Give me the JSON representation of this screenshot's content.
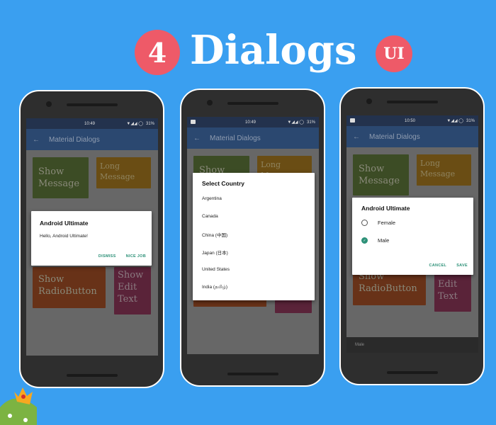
{
  "header": {
    "count": "4",
    "title": "Dialogs",
    "badge": "UI"
  },
  "colors": {
    "background": "#3a9ff0",
    "badge": "#ee5a68",
    "appbar": "#2b4870",
    "accent": "#2d9178"
  },
  "app": {
    "title": "Material Dialogs",
    "battery": "31%",
    "tiles": {
      "show_message": "Show Message",
      "long_message": "Long Message",
      "show_radio": "Show RadioButton",
      "show_edit": "Show Edit Text"
    }
  },
  "phones": [
    {
      "time": "10:49",
      "dialog": {
        "title": "Android Ultimate",
        "message": "Hello, Android Ultimate!",
        "dismiss": "DISMISS",
        "confirm": "NICE JOB"
      }
    },
    {
      "time": "10:49",
      "dialog": {
        "title": "Select Country",
        "items": [
          "Argentina",
          "Canada",
          "China (中国)",
          "Japan (日本)",
          "United States",
          "India (தமிழ்)"
        ]
      }
    },
    {
      "time": "10:50",
      "dialog": {
        "title": "Android Ultimate",
        "options": [
          {
            "label": "Female",
            "selected": false
          },
          {
            "label": "Male",
            "selected": true
          }
        ],
        "cancel": "CANCEL",
        "save": "SAVE"
      },
      "snackbar": "Male"
    }
  ]
}
